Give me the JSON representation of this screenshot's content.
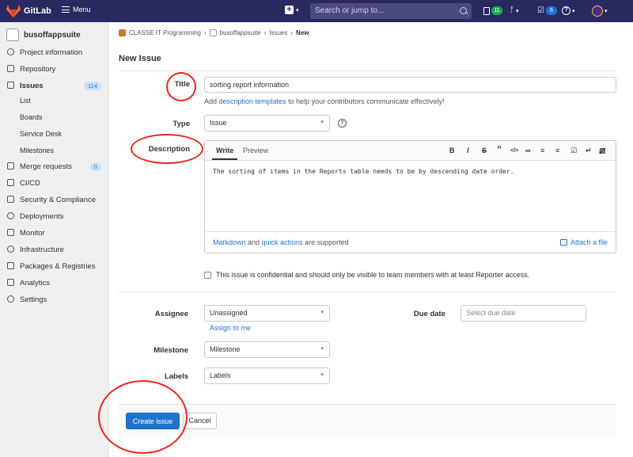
{
  "topbar": {
    "brand": "GitLab",
    "menu_label": "Menu",
    "search_placeholder": "Search or jump to...",
    "issues_count": "11",
    "todos_count": "6",
    "colors": {
      "bg": "#292961",
      "issues_badge": "#1aaa55",
      "todos_badge": "#1f75cb"
    }
  },
  "sidebar": {
    "project_name": "busoffappsuite",
    "items": [
      {
        "label": "Project information",
        "icon": "info-icon"
      },
      {
        "label": "Repository",
        "icon": "doc-icon"
      },
      {
        "label": "Issues",
        "icon": "issues-icon",
        "count": "114"
      },
      {
        "label": "Merge requests",
        "icon": "merge-icon",
        "count": "0"
      },
      {
        "label": "CI/CD",
        "icon": "rocket-icon"
      },
      {
        "label": "Security & Compliance",
        "icon": "shield-icon"
      },
      {
        "label": "Deployments",
        "icon": "deploy-icon"
      },
      {
        "label": "Monitor",
        "icon": "monitor-icon"
      },
      {
        "label": "Infrastructure",
        "icon": "cloud-icon"
      },
      {
        "label": "Packages & Registries",
        "icon": "package-icon"
      },
      {
        "label": "Analytics",
        "icon": "chart-icon"
      },
      {
        "label": "Settings",
        "icon": "gear-icon"
      }
    ],
    "issues_sub": [
      "List",
      "Boards",
      "Service Desk",
      "Milestones"
    ]
  },
  "breadcrumb": {
    "group": "CLASSE IT Programming",
    "project": "busoffappsuite",
    "section": "Issues",
    "current": "New"
  },
  "page_title": "New Issue",
  "form": {
    "title_label": "Title",
    "title_value": "sorting report information",
    "help_pre": "Add ",
    "help_link": "description templates",
    "help_post": " to help your contributors communicate effectively!",
    "type_label": "Type",
    "type_value": "Issue",
    "description_label": "Description",
    "tab_write": "Write",
    "tab_preview": "Preview",
    "toolbar": [
      "B",
      "I",
      "S",
      "”",
      "</>",
      "∞",
      "≡",
      "≡",
      "☑",
      "↵",
      "▦",
      "⤢"
    ],
    "description_value": "The sorting of items in the Reports table needs to be by descending date order.",
    "md_link": "Markdown",
    "md_and": " and ",
    "qa_link": "quick actions",
    "md_post": " are supported",
    "attach": "Attach a file",
    "confidential": "This issue is confidential and should only be visible to team members with at least Reporter access.",
    "assignee_label": "Assignee",
    "assignee_value": "Unassigned",
    "assign_to_me": "Assign to me",
    "due_label": "Due date",
    "due_placeholder": "Select due date",
    "milestone_label": "Milestone",
    "milestone_value": "Milestone",
    "labels_label": "Labels",
    "labels_value": "Labels"
  },
  "actions": {
    "create": "Create issue",
    "cancel": "Cancel"
  },
  "annotation_color": "#e8271e"
}
